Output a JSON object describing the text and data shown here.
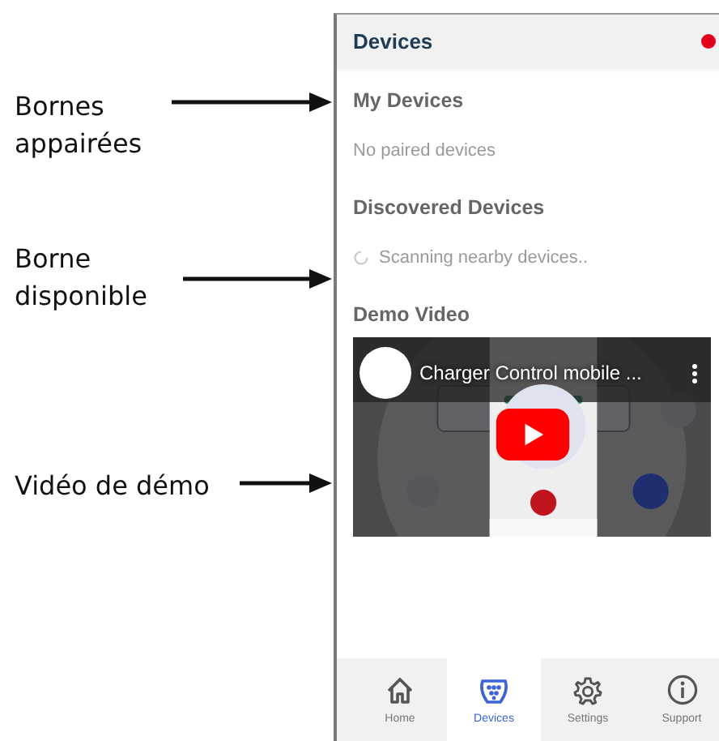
{
  "annotations": [
    {
      "text": "Bornes appairées"
    },
    {
      "text": "Borne disponible"
    },
    {
      "text": "Vidéo de démo"
    }
  ],
  "header": {
    "title": "Devices",
    "status_dot": {
      "color": "#e3001b"
    }
  },
  "sections": [
    {
      "kind": "list",
      "title": "My Devices",
      "message": "No paired devices"
    },
    {
      "kind": "scanning",
      "title": "Discovered Devices",
      "message": "Scanning nearby devices.."
    },
    {
      "kind": "video",
      "title": "Demo Video",
      "video_title": "Charger Control mobile ..."
    }
  ],
  "nav": [
    {
      "label": "Home",
      "selected": false
    },
    {
      "label": "Devices",
      "selected": true
    },
    {
      "label": "Settings",
      "selected": false
    },
    {
      "label": "Support",
      "selected": false
    }
  ]
}
